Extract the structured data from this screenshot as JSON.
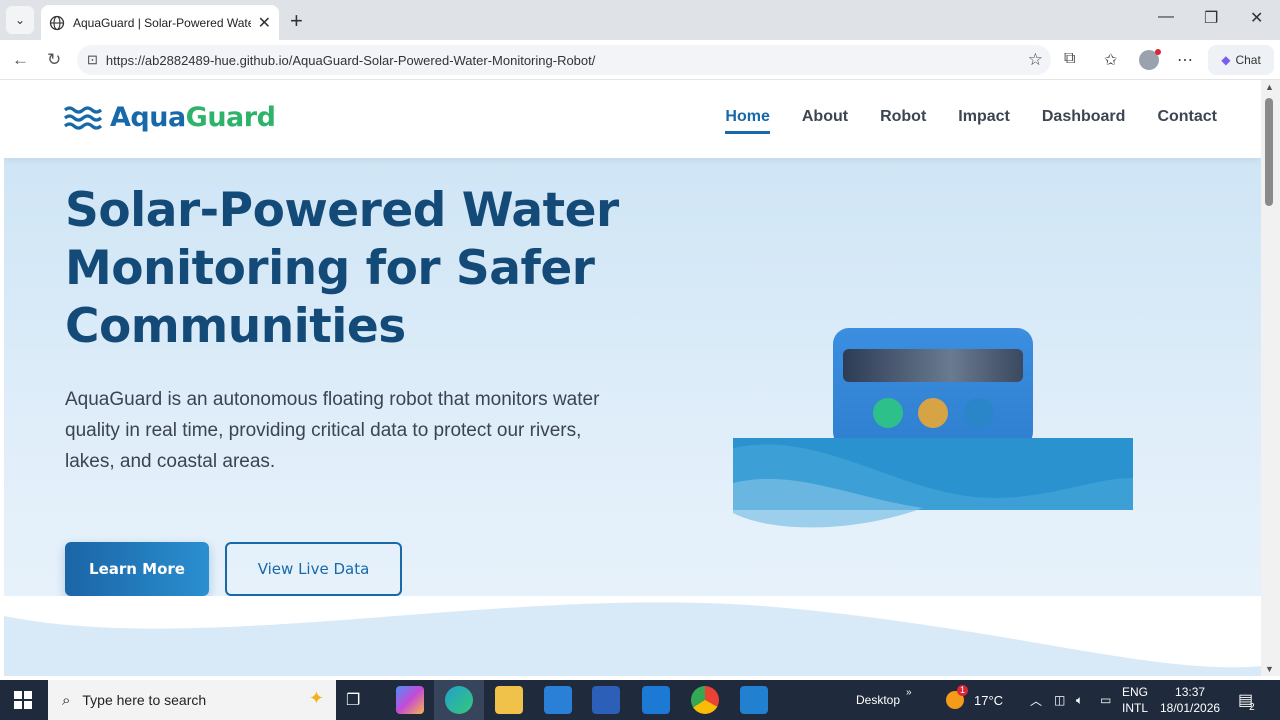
{
  "browser": {
    "tab_title": "AquaGuard | Solar-Powered Water",
    "url": "https://ab2882489-hue.github.io/AquaGuard-Solar-Powered-Water-Monitoring-Robot/",
    "chat_label": "Chat"
  },
  "site": {
    "brand_part1": "Aqua",
    "brand_part2": "Guard",
    "nav": [
      "Home",
      "About",
      "Robot",
      "Impact",
      "Dashboard",
      "Contact"
    ],
    "active_nav": "Home"
  },
  "hero": {
    "headline": "Solar-Powered Water Monitoring for Safer Communities",
    "description": "AquaGuard is an autonomous floating robot that monitors water quality in real time, providing critical data to protect our rivers, lakes, and coastal areas.",
    "primary_button": "Learn More",
    "secondary_button": "View Live Data"
  },
  "colors": {
    "brand_blue": "#1769aa",
    "brand_green": "#2fb36b",
    "headline": "#144a78"
  },
  "taskbar": {
    "search_placeholder": "Type here to search",
    "desktop_label": "Desktop",
    "temperature": "17°C",
    "weather_badge": "1",
    "language": "ENG",
    "layout": "INTL",
    "time": "13:37",
    "date": "18/01/2026",
    "notifications": "2"
  }
}
